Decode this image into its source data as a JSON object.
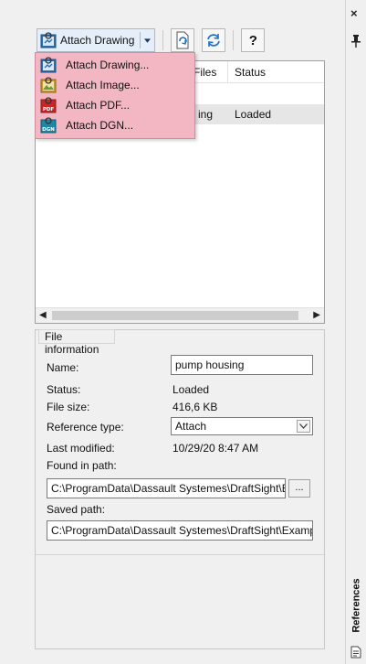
{
  "toolbar": {
    "attach_drawing_label": "Attach Drawing",
    "help_label": "?"
  },
  "menu": {
    "items": [
      {
        "label": "Attach Drawing...",
        "icon": "attach-drawing-icon"
      },
      {
        "label": "Attach Image...",
        "icon": "attach-image-icon"
      },
      {
        "label": "Attach PDF...",
        "icon": "attach-pdf-icon"
      },
      {
        "label": "Attach DGN...",
        "icon": "attach-dgn-icon"
      }
    ],
    "highlight_color": "#f3b7c4"
  },
  "list": {
    "columns": [
      "Files",
      "Status"
    ],
    "rows": [
      {
        "name_tail": "ing",
        "status": "Loaded",
        "selected": true
      }
    ]
  },
  "file_info": {
    "title": "File information",
    "name_label": "Name:",
    "name_value": "pump housing",
    "status_label": "Status:",
    "status_value": "Loaded",
    "size_label": "File size:",
    "size_value": "416,6 KB",
    "ref_type_label": "Reference type:",
    "ref_type_value": "Attach",
    "modified_label": "Last modified:",
    "modified_value": "10/29/20 8:47 AM",
    "found_label": "Found in path:",
    "found_value": "C:\\ProgramData\\Dassault Systemes\\DraftSight\\Exa",
    "browse_label": "...",
    "saved_label": "Saved path:",
    "saved_value": "C:\\ProgramData\\Dassault Systemes\\DraftSight\\Example"
  },
  "side": {
    "close_label": "×",
    "tab_label": "References"
  }
}
